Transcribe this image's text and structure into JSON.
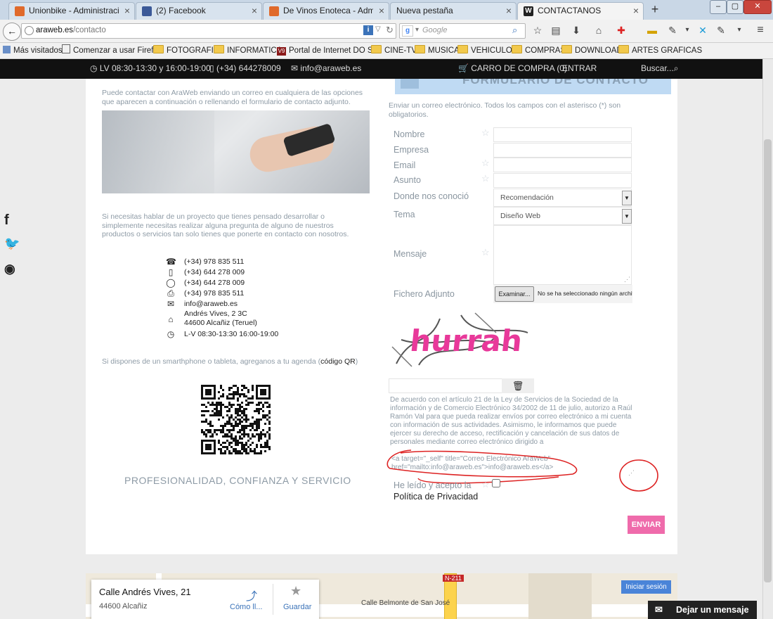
{
  "browser": {
    "tabs": [
      {
        "label": "Unionbike - Administració...",
        "icon_color": "#e06a2c"
      },
      {
        "label": "(2) Facebook",
        "icon_color": "#3b5998"
      },
      {
        "label": "De Vinos Enoteca - Admini...",
        "icon_color": "#e06a2c"
      },
      {
        "label": "Nueva pestaña",
        "icon_color": ""
      },
      {
        "label": "CONTACTANOS",
        "icon_color": "#222222"
      }
    ],
    "url_domain": "araweb.es",
    "url_path": "/contacto",
    "search_placeholder": "Google",
    "bookmarks": [
      {
        "label": "Más visitados",
        "icon": "bookmark-icon"
      },
      {
        "label": "Comenzar a usar Firefox",
        "icon": "page-icon"
      },
      {
        "label": "FOTOGRAFIA",
        "icon": "folder-icon"
      },
      {
        "label": "INFORMATICA",
        "icon": "folder-icon"
      },
      {
        "label": "Portal de Internet DO S...",
        "icon": "site-icon"
      },
      {
        "label": "CINE-TV",
        "icon": "folder-icon"
      },
      {
        "label": "MUSICA",
        "icon": "folder-icon"
      },
      {
        "label": "VEHICULOS",
        "icon": "folder-icon"
      },
      {
        "label": "COMPRAS",
        "icon": "folder-icon"
      },
      {
        "label": "DOWNLOAD",
        "icon": "folder-icon"
      },
      {
        "label": "ARTES GRAFICAS",
        "icon": "folder-icon"
      }
    ]
  },
  "site": {
    "topbar": {
      "hours": "LV 08:30-13:30 y 16:00-19:00",
      "phone": "(+34) 644278009",
      "email": "info@araweb.es",
      "cart": "CARRO DE COMPRA (0)",
      "login": "ENTRAR",
      "search": "Buscar..."
    },
    "form_header": "FORMULARIO DE CONTACTO",
    "intro": "Puede contactar con AraWeb enviando un correo en cualquiera de las opciones que aparecen a continuación o rellenando el formulario de contacto adjunto.",
    "project_text": "Si necesitas hablar de un proyecto que tienes pensado desarrollar o simplemente necesitas realizar alguna pregunta de alguno de nuestros productos o servicios tan solo tienes que ponerte en contacto con nosotros.",
    "contact_lines": [
      {
        "icon": "phone-icon",
        "text": "(+34) 978 835 511"
      },
      {
        "icon": "mobile-icon",
        "text": "(+34) 644 278 009"
      },
      {
        "icon": "whatsapp-icon",
        "text": "(+34) 644 278 009"
      },
      {
        "icon": "fax-icon",
        "text": "(+34) 978 835 511"
      },
      {
        "icon": "mail-icon",
        "text": "info@araweb.es"
      }
    ],
    "address_line1": "Andrés Vives, 2 3C",
    "address_line2": "44600 Alcañiz (Teruel)",
    "schedule": "L-V 08:30-13:30 16:00-19:00",
    "qr_text_pre": "Si dispones de un smarthphone o tableta, agreganos a tu agenda (",
    "qr_link": "código QR",
    "qr_text_post": ")",
    "tagline": "PROFESIONALIDAD, CONFIANZA Y SERVICIO",
    "form": {
      "intro": "Enviar un correo electrónico. Todos los campos con el asterisco (*) son obligatorios.",
      "name_label": "Nombre",
      "company_label": "Empresa",
      "email_label": "Email",
      "subject_label": "Asunto",
      "source_label": "Donde nos conoció",
      "source_value": "Recomendación",
      "topic_label": "Tema",
      "topic_value": "Diseño Web",
      "message_label": "Mensaje",
      "file_label": "Fichero Adjunto",
      "file_button": "Examinar...",
      "file_status": "No se ha seleccionado ningún archivo.",
      "captcha_word": "hurrah",
      "legal": "De acuerdo con el artículo 21 de la Ley de Servicios de la Sociedad de la información y de Comercio Electrónico 34/2002 de 11 de julio, autorizo a Raúl Ramón Val para que pueda realizar envíos por correo electrónico a mi cuenta con información de sus actividades. Asimismo, le informamos que puede ejercer su derecho de acceso, rectificación y cancelación de sus datos de personales mediante correo electrónico dirigido a",
      "legal_code1": "<a target=\"_self\" title=\"Correo Electrónico AraWeb\"",
      "legal_code2": "href=\"mailto:info@araweb.es\">info@araweb.es</a>",
      "privacy_line1": "He leído y acepto la",
      "privacy_line2": "Política de Privacidad",
      "submit": "ENVIAR"
    },
    "map": {
      "street": "Calle Andrés Vives, 21",
      "city": "44600 Alcañiz",
      "directions": "Cómo ll...",
      "save": "Guardar",
      "signin": "Iniciar sesión",
      "road_label": "N-211",
      "street_label": "Calle Belmonte de San José"
    },
    "chat": "Dejar un mensaje"
  }
}
